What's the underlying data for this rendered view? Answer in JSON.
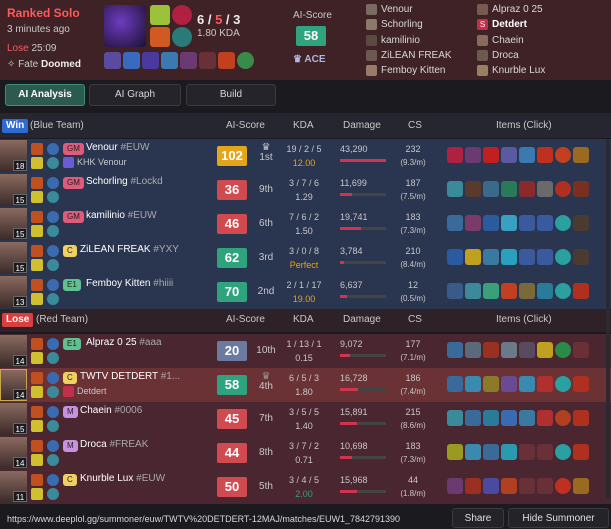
{
  "header": {
    "queue": "Ranked Solo",
    "ago": "3 minutes ago",
    "result": "Lose",
    "duration": "25:09",
    "fate_label": "Fate",
    "fate_value": "Doomed",
    "k": "6",
    "d": "5",
    "a": "3",
    "kda_ratio": "1.80 KDA",
    "ai_score_label": "AI-Score",
    "ai_score": "58",
    "ace": "ACE"
  },
  "players_left": [
    "Venour",
    "Schorling",
    "kamilinio",
    "ZiLEAN FREAK",
    "Femboy Kitten"
  ],
  "players_right": [
    "Alpraz 0 25",
    "Detdert",
    "Chaein",
    "Droca",
    "Knurble Lux"
  ],
  "tabs": [
    "AI Analysis",
    "AI Graph",
    "Build"
  ],
  "blue": {
    "badge": "Win",
    "name": "(Blue Team)",
    "h_score": "AI-Score",
    "h_kda": "KDA",
    "h_dmg": "Damage",
    "h_cs": "CS",
    "h_items": "Items (Click)"
  },
  "red": {
    "badge": "Lose",
    "name": "(Red Team)",
    "h_score": "AI-Score",
    "h_kda": "KDA",
    "h_dmg": "Damage",
    "h_cs": "CS",
    "h_items": "Items (Click)"
  },
  "rows": [
    {
      "lvl": "18",
      "rank": "GM",
      "name": "Venour",
      "tag": "#EUW",
      "sub": "KHK Venour",
      "score": "102",
      "place": "1st",
      "kda": "19 / 2 / 5",
      "ratio": "12.00",
      "dmg": "43,290",
      "cs": "232",
      "csm": "(9.3/m)"
    },
    {
      "lvl": "15",
      "rank": "GM",
      "name": "Schorling",
      "tag": "#Lockd",
      "sub": "",
      "score": "36",
      "place": "9th",
      "kda": "3 / 7 / 6",
      "ratio": "1.29",
      "dmg": "11,699",
      "cs": "187",
      "csm": "(7.5/m)"
    },
    {
      "lvl": "15",
      "rank": "GM",
      "name": "kamilinio",
      "tag": "#EUW",
      "sub": "",
      "score": "46",
      "place": "6th",
      "kda": "7 / 6 / 2",
      "ratio": "1.50",
      "dmg": "19,741",
      "cs": "183",
      "csm": "(7.3/m)"
    },
    {
      "lvl": "15",
      "rank": "C",
      "name": "ZiLEAN FREAK",
      "tag": "#YXY",
      "sub": "",
      "score": "62",
      "place": "3rd",
      "kda": "3 / 0 / 8",
      "ratio": "Perfect",
      "dmg": "3,784",
      "cs": "210",
      "csm": "(8.4/m)"
    },
    {
      "lvl": "13",
      "rank": "E1",
      "name": "Femboy Kitten",
      "tag": "#hiiii",
      "sub": "",
      "score": "70",
      "place": "2nd",
      "kda": "2 / 1 / 17",
      "ratio": "19.00",
      "dmg": "6,637",
      "cs": "12",
      "csm": "(0.5/m)"
    },
    {
      "lvl": "14",
      "rank": "E1",
      "name": "Alpraz 0 25",
      "tag": "#aaa",
      "sub": "",
      "score": "20",
      "place": "10th",
      "kda": "1 / 13 / 1",
      "ratio": "0.15",
      "dmg": "9,072",
      "cs": "177",
      "csm": "(7.1/m)"
    },
    {
      "lvl": "14",
      "rank": "C",
      "name": "TWTV DETDERT",
      "tag": "#1...",
      "sub": "Detdert",
      "score": "58",
      "place": "4th",
      "kda": "6 / 5 / 3",
      "ratio": "1.80",
      "dmg": "16,728",
      "cs": "186",
      "csm": "(7.4/m)"
    },
    {
      "lvl": "15",
      "rank": "M",
      "name": "Chaein",
      "tag": "#0006",
      "sub": "",
      "score": "45",
      "place": "7th",
      "kda": "3 / 5 / 5",
      "ratio": "1.40",
      "dmg": "15,891",
      "cs": "215",
      "csm": "(8.6/m)"
    },
    {
      "lvl": "14",
      "rank": "M",
      "name": "Droca",
      "tag": "#FREAK",
      "sub": "",
      "score": "44",
      "place": "8th",
      "kda": "3 / 7 / 2",
      "ratio": "0.71",
      "dmg": "10,698",
      "cs": "183",
      "csm": "(7.3/m)"
    },
    {
      "lvl": "11",
      "rank": "C",
      "name": "Knurble Lux",
      "tag": "#EUW",
      "sub": "",
      "score": "50",
      "place": "5th",
      "kda": "3 / 4 / 5",
      "ratio": "2.00",
      "dmg": "15,968",
      "cs": "44",
      "csm": "(1.8/m)"
    }
  ],
  "url": "https://www.deeplol.gg/summoner/euw/TWTV%20DETDERT-12MAJ/matches/EUW1_7842791390",
  "share": "Share",
  "hide": "Hide Summoner"
}
